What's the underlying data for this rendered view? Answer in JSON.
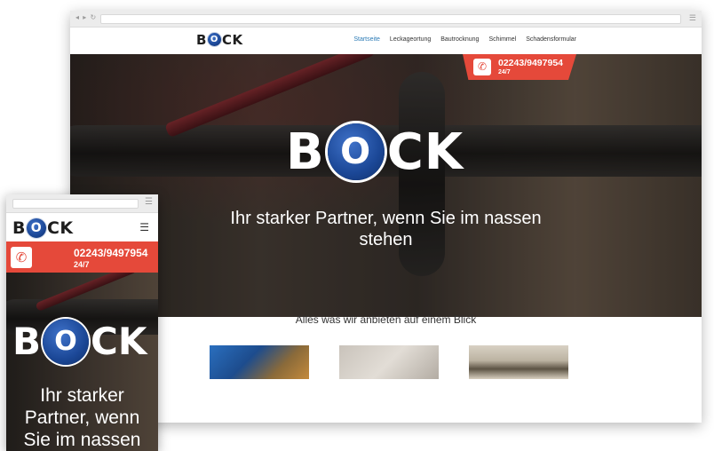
{
  "brand": {
    "logo_prefix": "B",
    "logo_letter": "O",
    "logo_suffix": "CK"
  },
  "desktop": {
    "nav": [
      {
        "label": "Startseite",
        "active": true
      },
      {
        "label": "Leckageortung"
      },
      {
        "label": "Bautrocknung"
      },
      {
        "label": "Schimmel"
      },
      {
        "label": "Schadensformular"
      }
    ],
    "phone": {
      "number": "02243/9497954",
      "availability": "24/7",
      "icon": "phone-icon"
    },
    "hero": {
      "tagline": "Ihr starker Partner, wenn Sie im nassen stehen"
    },
    "section_title": "Alles was wir anbieten auf einem Blick"
  },
  "mobile": {
    "phone": {
      "number": "02243/9497954",
      "availability": "24/7",
      "icon": "phone-icon"
    },
    "hero": {
      "tagline": "Ihr starker Partner, wenn Sie im nassen"
    }
  },
  "colors": {
    "accent_red": "#e5493a",
    "nav_active": "#2c7bb6",
    "logo_blue": "#1b4796"
  }
}
